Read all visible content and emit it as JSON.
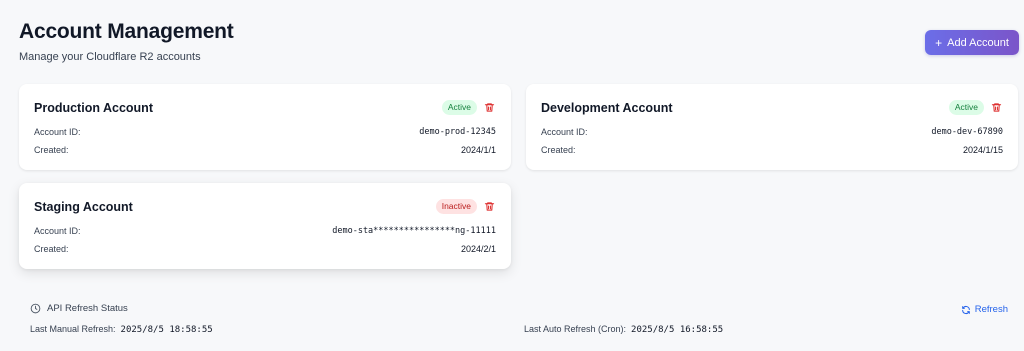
{
  "header": {
    "title": "Account Management",
    "subtitle": "Manage your Cloudflare R2 accounts",
    "add_button_label": "Add Account",
    "add_button_icon": "plus-icon"
  },
  "accounts": [
    {
      "name": "Production Account",
      "status": "Active",
      "account_id_label": "Account ID:",
      "account_id": "demo-prod-12345",
      "created_label": "Created:",
      "created": "2024/1/1"
    },
    {
      "name": "Development Account",
      "status": "Active",
      "account_id_label": "Account ID:",
      "account_id": "demo-dev-67890",
      "created_label": "Created:",
      "created": "2024/1/15"
    },
    {
      "name": "Staging Account",
      "status": "Inactive",
      "account_id_label": "Account ID:",
      "account_id": "demo-sta****************ng-11111",
      "created_label": "Created:",
      "created": "2024/2/1"
    }
  ],
  "refresh_status": {
    "title": "API Refresh Status",
    "refresh_link": "Refresh",
    "manual_label": "Last Manual Refresh:",
    "manual_value": "2025/8/5 18:58:55",
    "auto_label": "Last Auto Refresh (Cron):",
    "auto_value": "2025/8/5 16:58:55"
  },
  "colors": {
    "accent_start": "#6b6ee8",
    "accent_end": "#7b55c9",
    "active_bg": "#dcfce7",
    "active_text": "#15803d",
    "inactive_bg": "#fee2e2",
    "inactive_text": "#b91c1c",
    "link": "#2563eb",
    "delete": "#dc2626"
  }
}
